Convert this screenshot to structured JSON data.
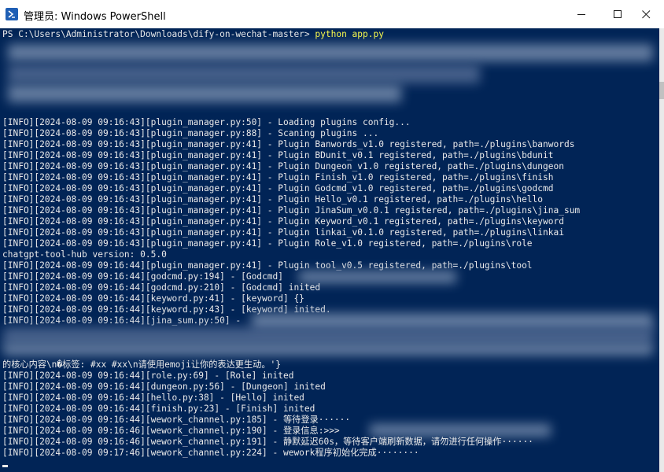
{
  "window": {
    "title": "管理员: Windows PowerShell",
    "controls": {
      "minimize": "minimize-icon",
      "maximize": "maximize-icon",
      "close": "close-icon"
    }
  },
  "console": {
    "prompt_path": "PS C:\\Users\\Administrator\\Downloads\\dify-on-wechat-master> ",
    "prompt_command": "python app.py",
    "lines": [
      "[INFO][2024-08-09 09:16:43][plugin_manager.py:50] - Loading plugins config...",
      "[INFO][2024-08-09 09:16:43][plugin_manager.py:88] - Scaning plugins ...",
      "[INFO][2024-08-09 09:16:43][plugin_manager.py:41] - Plugin Banwords_v1.0 registered, path=./plugins\\banwords",
      "[INFO][2024-08-09 09:16:43][plugin_manager.py:41] - Plugin BDunit_v0.1 registered, path=./plugins\\bdunit",
      "[INFO][2024-08-09 09:16:43][plugin_manager.py:41] - Plugin Dungeon_v1.0 registered, path=./plugins\\dungeon",
      "[INFO][2024-08-09 09:16:43][plugin_manager.py:41] - Plugin Finish_v1.0 registered, path=./plugins\\finish",
      "[INFO][2024-08-09 09:16:43][plugin_manager.py:41] - Plugin Godcmd_v1.0 registered, path=./plugins\\godcmd",
      "[INFO][2024-08-09 09:16:43][plugin_manager.py:41] - Plugin Hello_v0.1 registered, path=./plugins\\hello",
      "[INFO][2024-08-09 09:16:43][plugin_manager.py:41] - Plugin JinaSum_v0.0.1 registered, path=./plugins\\jina_sum",
      "[INFO][2024-08-09 09:16:43][plugin_manager.py:41] - Plugin Keyword_v0.1 registered, path=./plugins\\keyword",
      "[INFO][2024-08-09 09:16:43][plugin_manager.py:41] - Plugin linkai_v0.1.0 registered, path=./plugins\\linkai",
      "[INFO][2024-08-09 09:16:43][plugin_manager.py:41] - Plugin Role_v1.0 registered, path=./plugins\\role",
      "chatgpt-tool-hub version: 0.5.0",
      "[INFO][2024-08-09 09:16:44][plugin_manager.py:41] - Plugin tool_v0.5 registered, path=./plugins\\tool",
      "[INFO][2024-08-09 09:16:44][godcmd.py:194] - [Godcmd]",
      "[INFO][2024-08-09 09:16:44][godcmd.py:210] - [Godcmd] inited",
      "[INFO][2024-08-09 09:16:44][keyword.py:41] - [keyword] {}",
      "[INFO][2024-08-09 09:16:44][keyword.py:43] - [keyword] inited.",
      "[INFO][2024-08-09 09:16:44][jina_sum.py:50] - ",
      "的核心内容\\n�标签: #xx #xx\\n请使用emoji让你的表达更生动。'}",
      "[INFO][2024-08-09 09:16:44][role.py:69] - [Role] inited",
      "[INFO][2024-08-09 09:16:44][dungeon.py:56] - [Dungeon] inited",
      "[INFO][2024-08-09 09:16:44][hello.py:38] - [Hello] inited",
      "[INFO][2024-08-09 09:16:44][finish.py:23] - [Finish] inited",
      "[INFO][2024-08-09 09:16:44][wework_channel.py:185] - 等待登录······",
      "[INFO][2024-08-09 09:16:46][wework_channel.py:190] - 登录信息:>>>",
      "[INFO][2024-08-09 09:16:46][wework_channel.py:191] - 静默延迟60s，等待客户端刷新数据，请勿进行任何操作······",
      "[INFO][2024-08-09 09:17:46][wework_channel.py:224] - wework程序初始化完成········"
    ]
  },
  "colors": {
    "console_bg": "#012456",
    "console_fg": "#eaeaea",
    "command": "#ffff4a",
    "titlebar_bg": "#ffffff"
  }
}
